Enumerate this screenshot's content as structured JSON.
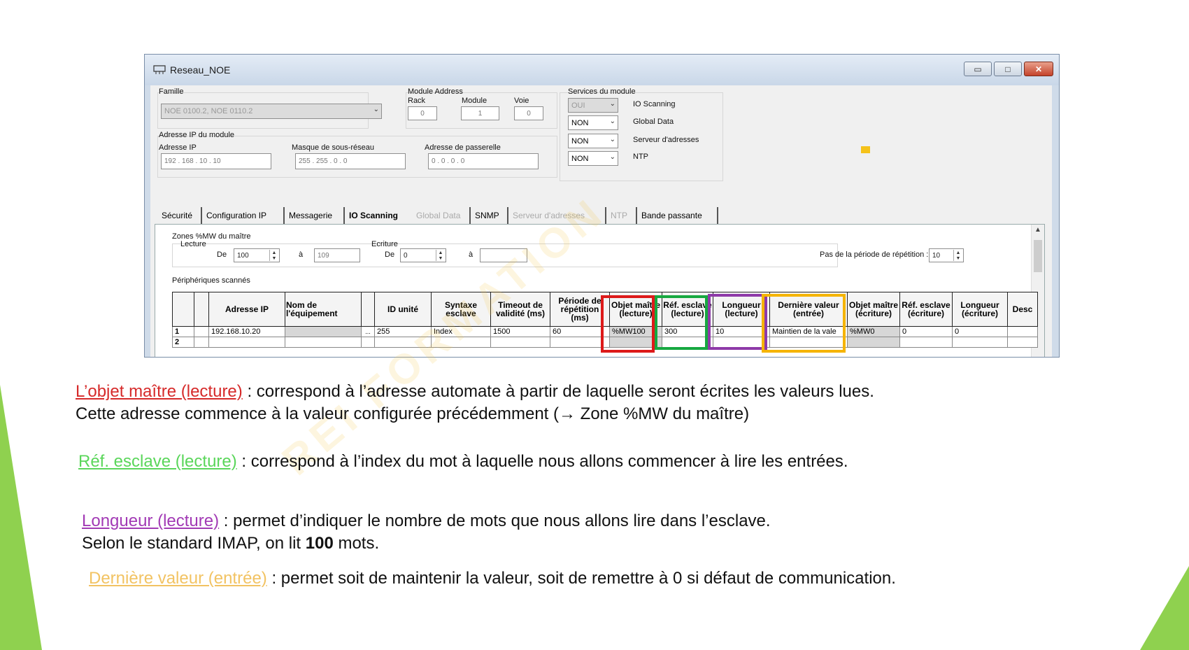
{
  "colors": {
    "red": "#dd1a1a",
    "green": "#17a840",
    "purple": "#8e3aa8",
    "yellow": "#f5b400",
    "term_red": "#d62a2a",
    "term_green": "#5ad65a",
    "term_purple": "#a23ab5",
    "term_yellow": "#f2c363",
    "deco_green": "#8fd14f"
  },
  "window": {
    "title": "Reseau_NOE",
    "buttons": {
      "minimize": "▭",
      "maximize": "□",
      "close": "✕"
    }
  },
  "module": {
    "famille_label": "Famille",
    "famille_value": "NOE 0100.2, NOE 0110.2",
    "module_address_label": "Module Address",
    "rack_label": "Rack",
    "rack_value": "0",
    "module_label": "Module",
    "module_value": "1",
    "voie_label": "Voie",
    "voie_value": "0",
    "ip_group_label": "Adresse IP du module",
    "ip_label": "Adresse IP",
    "ip_value": "192  .  168  .  10  .  10",
    "mask_label": "Masque de sous-réseau",
    "mask_value": "255  .  255  .  0  .  0",
    "gateway_label": "Adresse de passerelle",
    "gateway_value": "0  .  0  .  0  .  0"
  },
  "services": {
    "label": "Services du module",
    "items": [
      {
        "value": "OUI",
        "name": "IO Scanning"
      },
      {
        "value": "NON",
        "name": "Global Data"
      },
      {
        "value": "NON",
        "name": "Serveur d'adresses"
      },
      {
        "value": "NON",
        "name": "NTP"
      }
    ]
  },
  "tabs": [
    {
      "label": "Sécurité"
    },
    {
      "label": "Configuration IP"
    },
    {
      "label": "Messagerie"
    },
    {
      "label": "IO Scanning"
    },
    {
      "label": "Global Data"
    },
    {
      "label": "SNMP"
    },
    {
      "label": "Serveur d'adresses"
    },
    {
      "label": "NTP"
    },
    {
      "label": "Bande passante"
    }
  ],
  "zones": {
    "label": "Zones %MW du maître",
    "lecture_label": "Lecture",
    "de_label": "De",
    "lecture_de": "100",
    "a_label": "à",
    "lecture_a": "109",
    "ecriture_label": "Ecriture",
    "ecriture_de": "0",
    "ecriture_a": "",
    "pas_label": "Pas de la période de répétition :",
    "pas_value": "10"
  },
  "peripheriques": {
    "label": "Périphériques scannés",
    "headers": [
      "Adresse IP",
      "Nom de l'équipement",
      "ID unité",
      "Syntaxe esclave",
      "Timeout de validité (ms)",
      "Période de répétition (ms)",
      "Objet maître (lecture)",
      "Réf. esclave (lecture)",
      "Longueur (lecture)",
      "Dernière valeur (entrée)",
      "Objet maître (écriture)",
      "Réf. esclave (écriture)",
      "Longueur (écriture)",
      "Desc"
    ],
    "rows": [
      {
        "num": "1",
        "ip": "192.168.10.20",
        "name": "",
        "id": "255",
        "syntaxe": "Index",
        "timeout": "1500",
        "periode": "60",
        "obj_lecture": "%MW100",
        "ref_lecture": "300",
        "long_lecture": "10",
        "derniere": "Maintien de la vale",
        "obj_ecriture": "%MW0",
        "ref_ecriture": "0",
        "long_ecriture": "0",
        "desc": ""
      },
      {
        "num": "2",
        "ip": "",
        "name": "",
        "id": "",
        "syntaxe": "",
        "timeout": "",
        "periode": "",
        "obj_lecture": "",
        "ref_lecture": "",
        "long_lecture": "",
        "derniere": "",
        "obj_ecriture": "",
        "ref_ecriture": "",
        "long_ecriture": "",
        "desc": ""
      }
    ]
  },
  "explanations": {
    "objet_term": "L’objet maître (lecture)",
    "objet_text": " : correspond à l’adresse automate à partir de laquelle seront écrites les valeurs lues.",
    "objet_line2": "Cette adresse commence à la valeur configurée précédemment (→ Zone %MW du maître)",
    "ref_term": "Réf. esclave (lecture)",
    "ref_text": " : correspond à l’index du mot à laquelle nous allons commencer à lire les entrées.",
    "long_term": "Longueur (lecture)",
    "long_text": " : permet d’indiquer le nombre de mots que nous allons lire dans l’esclave.",
    "long_line2_a": "Selon le standard IMAP, on lit ",
    "long_line2_b": "100",
    "long_line2_c": " mots.",
    "dern_term": "Dernière valeur (entrée)",
    "dern_text": " : permet soit de maintenir la valeur, soit de remettre à 0 si défaut de communication."
  }
}
